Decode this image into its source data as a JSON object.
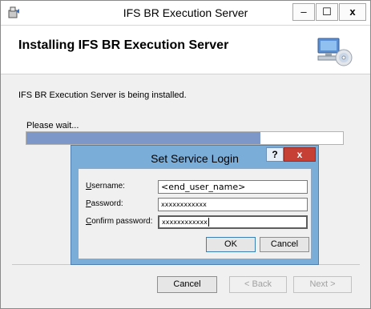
{
  "window": {
    "title": "IFS BR Execution Server",
    "min_glyph": "‒",
    "max_glyph": "☐",
    "close_glyph": "x"
  },
  "header": {
    "title": "Installing IFS BR Execution Server"
  },
  "body": {
    "status_text": "IFS BR Execution Server is being installed.",
    "wait_text": "Please wait...",
    "progress_fraction": 0.74
  },
  "footer": {
    "cancel_label": "Cancel",
    "back_label": "< Back",
    "next_label": "Next >"
  },
  "dialog": {
    "title": "Set Service Login",
    "help_glyph": "?",
    "close_glyph": "x",
    "username_label_accel": "U",
    "username_label_rest": "sername:",
    "username_value": "<end_user_name>",
    "password_label_accel": "P",
    "password_label_rest": "assword:",
    "password_value": "xxxxxxxxxxxx",
    "confirm_label_accel": "C",
    "confirm_label_rest": "onfirm password:",
    "confirm_value": "xxxxxxxxxxxx",
    "ok_label": "OK",
    "cancel_label": "Cancel"
  },
  "colors": {
    "progress_fill": "#7d98c8",
    "dialog_frame": "#7badd9",
    "close_button": "#c74036"
  },
  "icons": {
    "app": "installer-icon",
    "header": "computer-disc-icon"
  }
}
